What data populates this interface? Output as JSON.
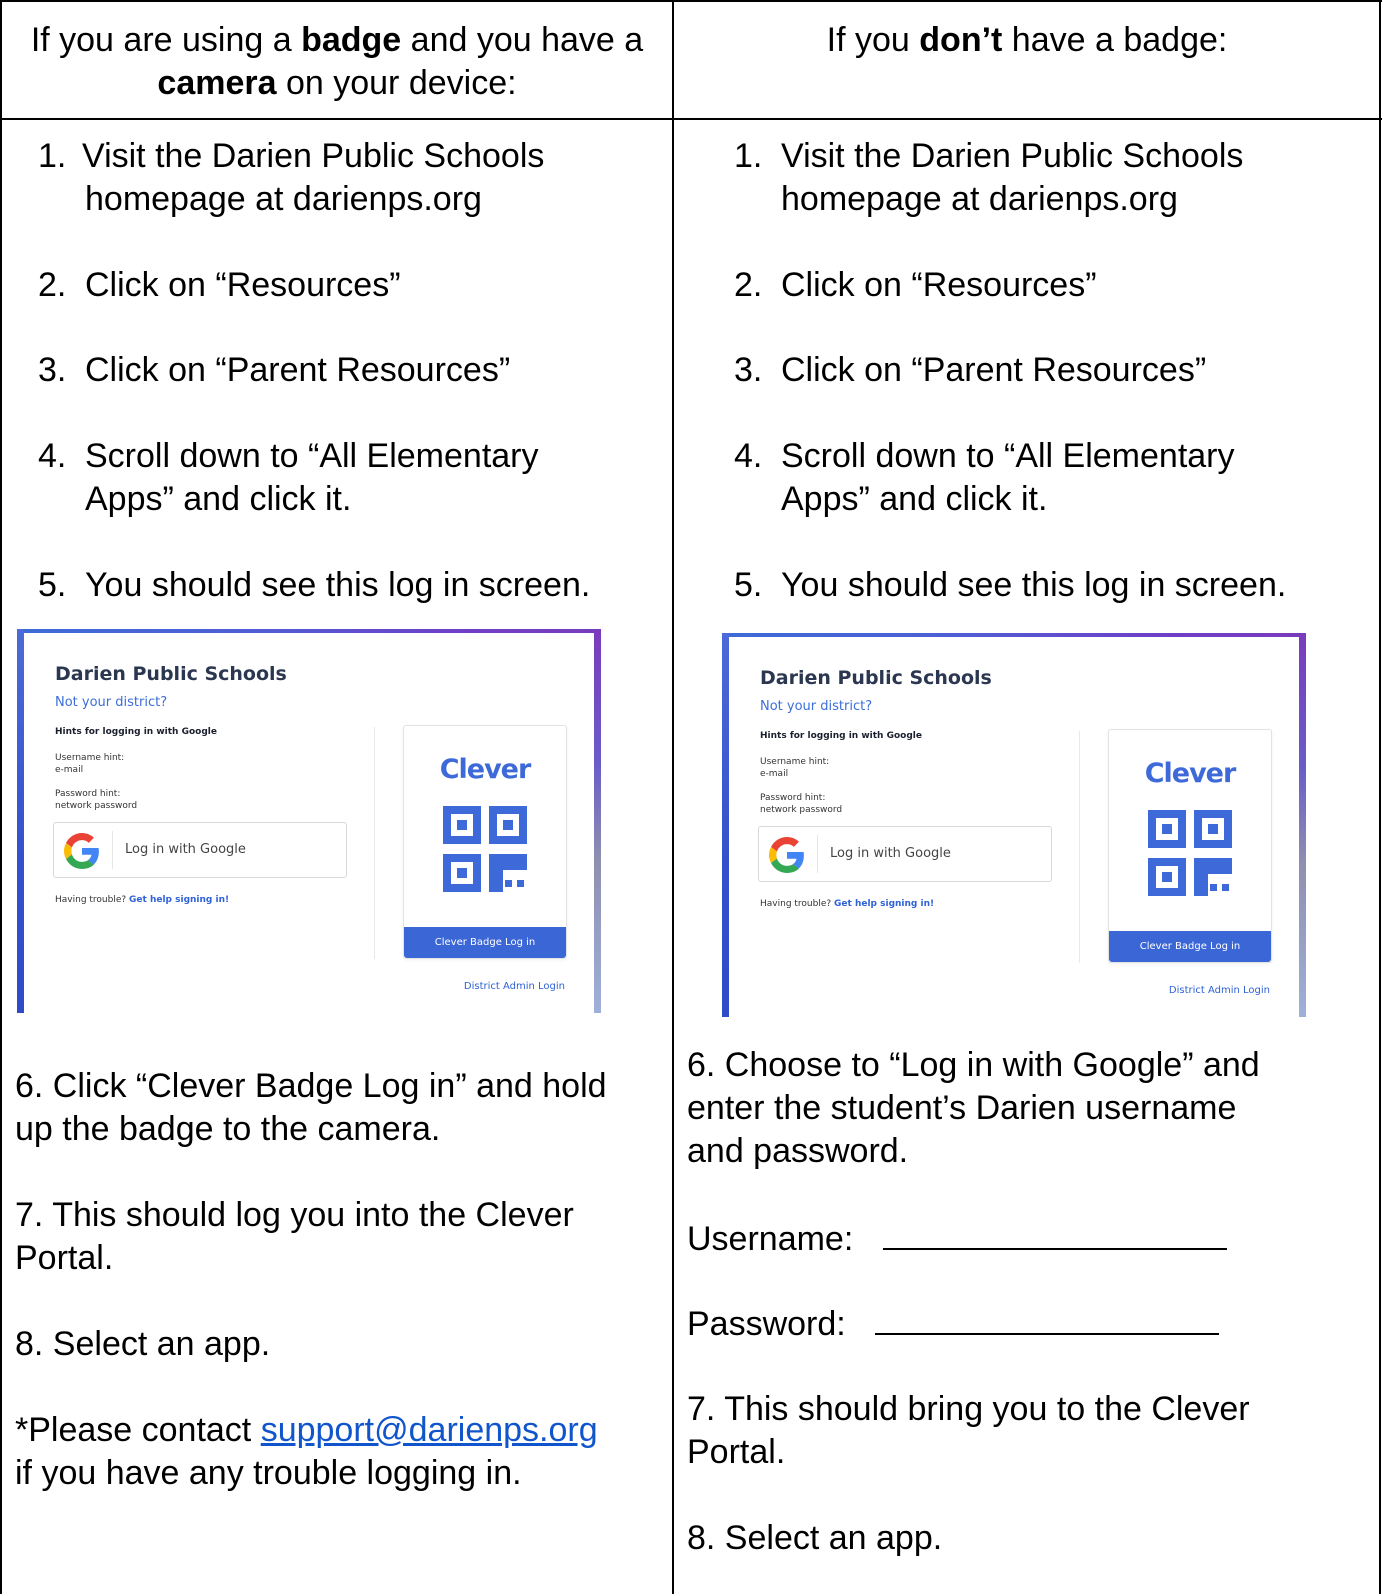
{
  "header": {
    "left": {
      "t1": "If you are using a ",
      "b1": "badge",
      "t2": " and you have a ",
      "b2": "camera",
      "t3": " on your device:"
    },
    "right": {
      "t1": "If you ",
      "b1": "don’t",
      "t2": " have a badge:"
    }
  },
  "left": {
    "steps": [
      {
        "num": "1.",
        "line1": " Visit the Darien Public Schools",
        "line2": "homepage at darienps.org"
      },
      {
        "num": "2.",
        "line1": "Click on “Resources”"
      },
      {
        "num": "3.",
        "line1": "Click on “Parent Resources”"
      },
      {
        "num": "4.",
        "line1": "Scroll down to “All Elementary",
        "line2": "Apps” and click it."
      },
      {
        "num": "5.",
        "line1": "You should see this log in screen."
      }
    ],
    "step6_l1": "6. Click “Clever Badge Log in” and hold",
    "step6_l2": "up the badge to the camera.",
    "step7_l1": "7. This should log you into the Clever",
    "step7_l2": "Portal.",
    "step8": "8. Select an app.",
    "contact_pre": "*Please contact ",
    "contact_email": "support@darienps.org",
    "contact_post": "if you have any trouble logging in."
  },
  "right": {
    "steps": [
      {
        "num": "1.",
        "line1": "Visit the Darien Public Schools",
        "line2": "homepage at darienps.org"
      },
      {
        "num": "2.",
        "line1": "Click on “Resources”"
      },
      {
        "num": "3.",
        "line1": "Click on “Parent Resources”"
      },
      {
        "num": "4.",
        "line1": "Scroll down to “All Elementary",
        "line2": "Apps” and click it."
      },
      {
        "num": "5.",
        "line1": "You should see this log in screen."
      }
    ],
    "step6_l1": "6. Choose to “Log in with Google” and",
    "step6_l2": "enter the student’s Darien username",
    "step6_l3": "and password.",
    "username_label": "Username:",
    "password_label": "Password:",
    "step7_l1": "7. This should bring you to the Clever",
    "step7_l2": "Portal.",
    "step8": "8. Select an app."
  },
  "login_card": {
    "district": "Darien Public Schools",
    "not_your_district": "Not your district?",
    "hints_title": "Hints for logging in with Google",
    "username_hint_label": "Username hint:",
    "username_hint_value": "e-mail",
    "password_hint_label": "Password hint:",
    "password_hint_value": "network password",
    "google_button": "Log in with Google",
    "trouble_text": "Having trouble? ",
    "trouble_link": "Get help signing in!",
    "clever_logo": "Clever",
    "badge_button": "Clever Badge Log in",
    "admin_link": "District Admin Login",
    "icons": [
      "google-g-icon",
      "qr-code-icon"
    ],
    "colors": {
      "clever_blue": "#3b66d6",
      "link_blue": "#2f62d6",
      "accent_purple": "#7a3bbd"
    }
  },
  "colors": {
    "email_link": "#1155cc",
    "text": "#000000"
  }
}
